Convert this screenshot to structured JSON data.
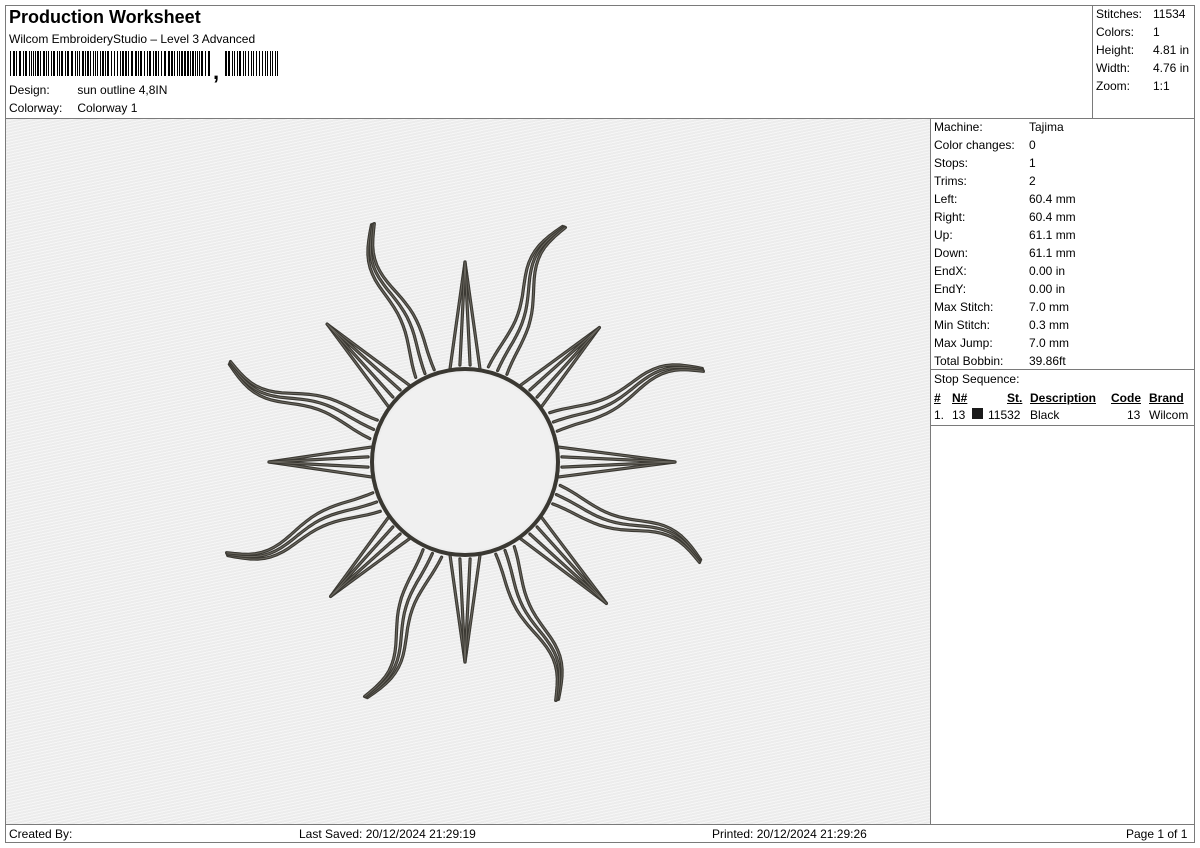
{
  "header": {
    "title": "Production Worksheet",
    "subtitle": "Wilcom EmbroideryStudio – Level 3 Advanced",
    "design_label": "Design:",
    "design_value": "sun outline 4,8IN",
    "colorway_label": "Colorway:",
    "colorway_value": "Colorway 1"
  },
  "summary": {
    "stitches_label": "Stitches:",
    "stitches_value": "11534",
    "colors_label": "Colors:",
    "colors_value": "1",
    "height_label": "Height:",
    "height_value": "4.81 in",
    "width_label": "Width:",
    "width_value": "4.76 in",
    "zoom_label": "Zoom:",
    "zoom_value": "1:1"
  },
  "info": {
    "rows": [
      {
        "label": "Machine:",
        "value": "Tajima"
      },
      {
        "label": "Color changes:",
        "value": "0"
      },
      {
        "label": "Stops:",
        "value": "1"
      },
      {
        "label": "Trims:",
        "value": "2"
      },
      {
        "label": "Left:",
        "value": "60.4 mm"
      },
      {
        "label": "Right:",
        "value": "60.4 mm"
      },
      {
        "label": "Up:",
        "value": "61.1 mm"
      },
      {
        "label": "Down:",
        "value": "61.1 mm"
      },
      {
        "label": "EndX:",
        "value": "0.00 in"
      },
      {
        "label": "EndY:",
        "value": "0.00 in"
      },
      {
        "label": "Max Stitch:",
        "value": "7.0 mm"
      },
      {
        "label": "Min Stitch:",
        "value": "0.3 mm"
      },
      {
        "label": "Max Jump:",
        "value": "7.0 mm"
      },
      {
        "label": "Total Bobbin:",
        "value": "39.86ft"
      }
    ],
    "stop_sequence_label": "Stop Sequence:",
    "stop_columns": {
      "num": "#",
      "needle": "N#",
      "stitches": "St.",
      "description": "Description",
      "code": "Code",
      "brand": "Brand"
    },
    "stops": [
      {
        "num": "1.",
        "needle": "13",
        "stitches": "11532",
        "description": "Black",
        "code": "13",
        "brand": "Wilcom",
        "color": "#1a1a1a"
      }
    ]
  },
  "footer": {
    "created_by": "Created By:",
    "last_saved": "Last Saved: 20/12/2024 21:29:19",
    "printed": "Printed: 20/12/2024 21:29:26",
    "page": "Page 1 of 1"
  },
  "colors": {
    "thread": "#3a3832",
    "canvas": "#ececec",
    "border": "#7a7a7a"
  }
}
